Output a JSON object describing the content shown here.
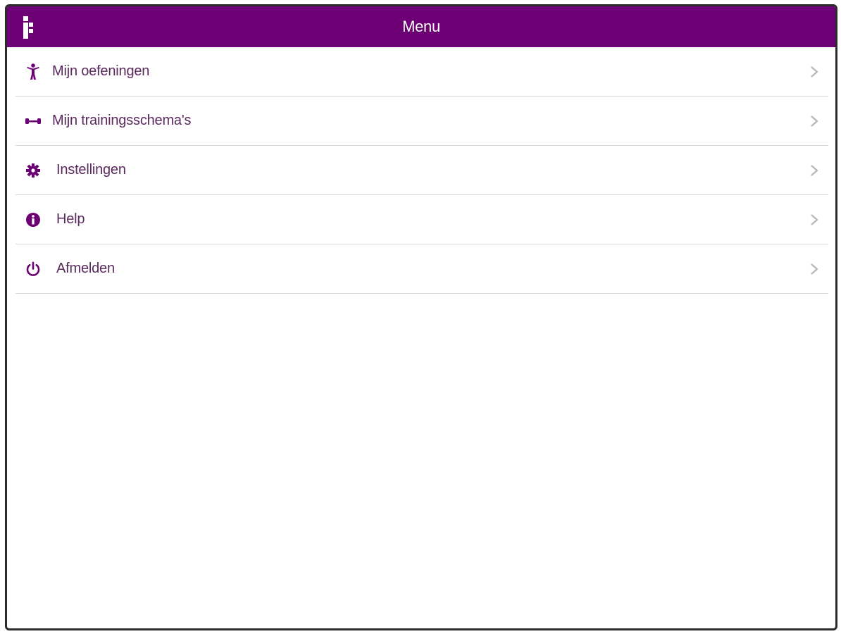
{
  "colors": {
    "brand": "#6e0075",
    "label": "#5a2a5e",
    "divider": "#d8d8d8",
    "chevron": "#b5b5b5"
  },
  "header": {
    "title": "Menu",
    "logo_icon": "app-logo-icon"
  },
  "menu": {
    "items": [
      {
        "label": "Mijn oefeningen",
        "icon": "person-icon"
      },
      {
        "label": "Mijn trainingsschema's",
        "icon": "dumbbell-icon"
      },
      {
        "label": "Instellingen",
        "icon": "gear-icon"
      },
      {
        "label": "Help",
        "icon": "info-icon"
      },
      {
        "label": "Afmelden",
        "icon": "power-icon"
      }
    ],
    "chevron_icon": "chevron-right-icon"
  }
}
